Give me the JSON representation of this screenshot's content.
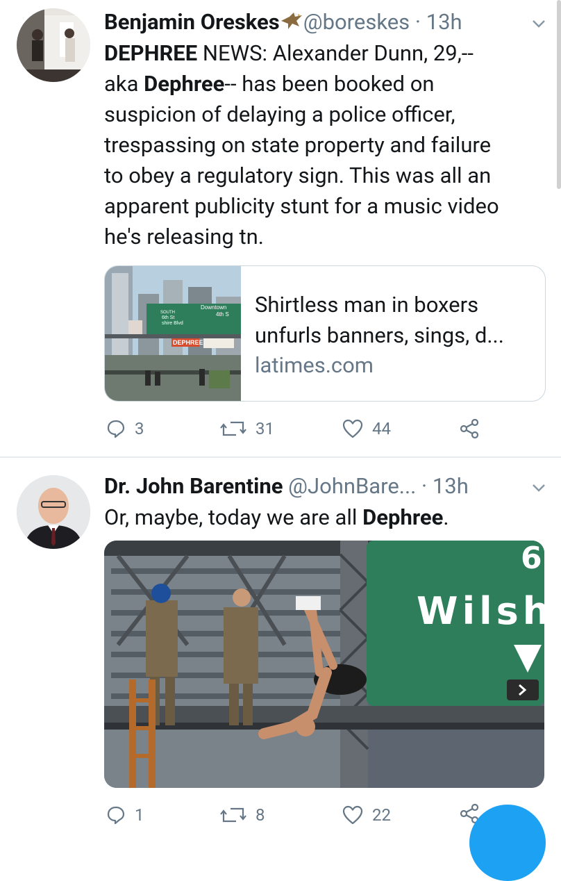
{
  "tweets": [
    {
      "name": "Benjamin Oreskes",
      "handle": "@boreskes",
      "dot": "·",
      "time": "13h",
      "text_parts": [
        {
          "t": "DEPHREE",
          "bold": true
        },
        {
          "t": " NEWS: Alexander Dunn, 29,--\naka ",
          "bold": false
        },
        {
          "t": "Dephree",
          "bold": true
        },
        {
          "t": "-- has been booked on\nsuspicion of delaying a police officer,\ntrespassing on state property and failure\nto obey a regulatory sign. This was all an\napparent publicity stunt for a music video\nhe's releasing tn.",
          "bold": false
        }
      ],
      "card": {
        "title": "Shirtless man in boxers unfurls banners, sings, d...",
        "domain": "latimes.com",
        "sign_text_1": "Downtown",
        "sign_text_2": "4th S",
        "sign_text_3": "SOUTH",
        "sign_text_4": "6th St",
        "sign_text_5": "shire Blvd",
        "banner_text": "DEPHREE"
      },
      "actions": {
        "reply": "3",
        "retweet": "31",
        "like": "44"
      }
    },
    {
      "name": "Dr. John Barentine",
      "handle": "@JohnBare...",
      "dot": "·",
      "time": "13h",
      "text_parts": [
        {
          "t": "Or, maybe, today we are all ",
          "bold": false
        },
        {
          "t": "Dephree",
          "bold": true
        },
        {
          "t": ".",
          "bold": false
        }
      ],
      "photo": {
        "sign_text": "Wilsh",
        "sign_number": "6"
      },
      "actions": {
        "reply": "1",
        "retweet": "8",
        "like": "22"
      }
    }
  ],
  "colors": {
    "accent": "#1da1f2",
    "muted": "#657786",
    "sign_green": "#2e7d5b"
  }
}
